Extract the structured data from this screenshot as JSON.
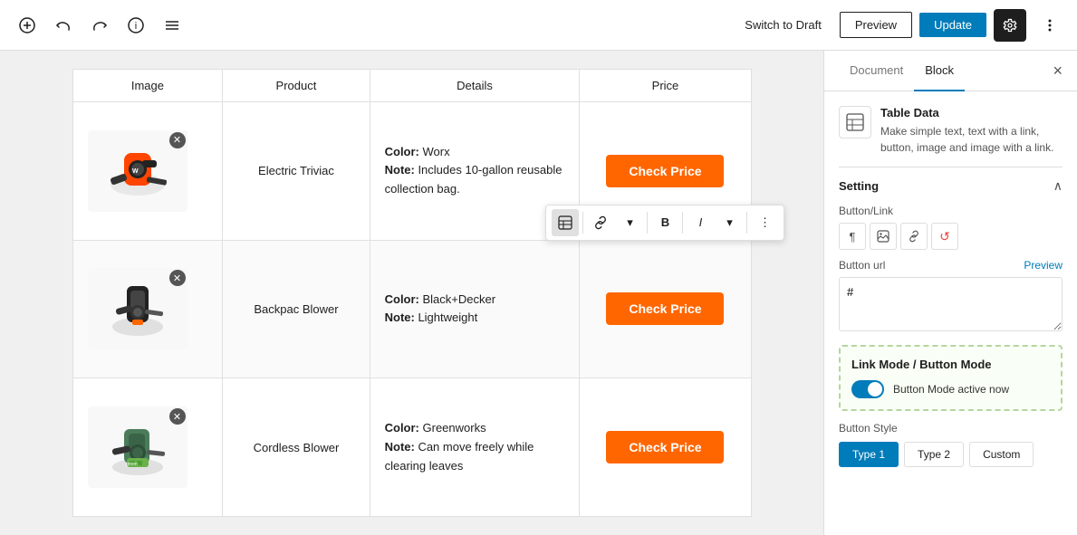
{
  "toolbar": {
    "switch_draft_label": "Switch to Draft",
    "preview_label": "Preview",
    "update_label": "Update"
  },
  "table": {
    "headers": [
      "Image",
      "Product",
      "Details",
      "Price"
    ],
    "rows": [
      {
        "id": "row-1",
        "product": "Electric Triviac",
        "details_color_label": "Color:",
        "details_color_value": " Worx",
        "details_note_label": "Note:",
        "details_note_value": " Includes 10-gallon reusable collection bag.",
        "price_button": "Check Price",
        "active": false
      },
      {
        "id": "row-2",
        "product": "Backpac Blower",
        "details_color_label": "Color:",
        "details_color_value": " Black+Decker",
        "details_note_label": "Note:",
        "details_note_value": " Lightweight",
        "price_button": "Check Price",
        "active": true
      },
      {
        "id": "row-3",
        "product": "Cordless Blower",
        "details_color_label": "Color:",
        "details_color_value": " Greenworks",
        "details_note_label": "Note:",
        "details_note_value": " Can move freely while clearing leaves",
        "price_button": "Check Price",
        "active": false
      }
    ]
  },
  "floating_toolbar": {
    "icon_btn_title": "Table Data Icon",
    "link_btn_title": "Link",
    "bold_btn_title": "B",
    "italic_btn_title": "I",
    "dropdown_title": "▾",
    "more_title": "⋮"
  },
  "right_panel": {
    "tab_document": "Document",
    "tab_block": "Block",
    "block_title": "Table Data",
    "block_description": "Make simple text, text with a link, button, image and image with a link.",
    "setting_title": "Setting",
    "button_link_label": "Button/Link",
    "btn_url_label": "Button url",
    "btn_url_preview": "Preview",
    "btn_url_value": "#",
    "mode_title": "Link Mode / Button Mode",
    "mode_status": "Button Mode active now",
    "btn_style_label": "Button Style",
    "btn_style_options": [
      "Type 1",
      "Type 2",
      "Custom"
    ],
    "btn_style_active": "Type 1"
  }
}
